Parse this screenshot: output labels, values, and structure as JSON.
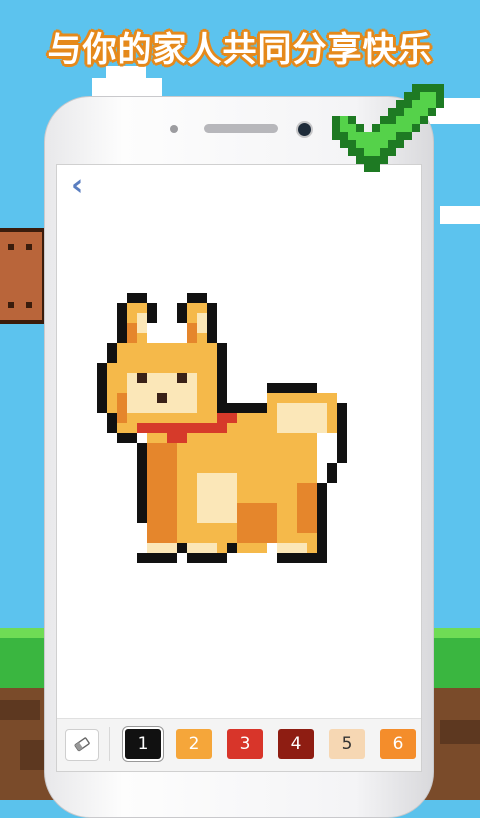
{
  "banner": {
    "text": "与你的家人共同分享快乐"
  },
  "screen": {
    "back_label": "‹"
  },
  "palette": {
    "eraser_icon": "eraser-icon",
    "colors": [
      {
        "label": "1",
        "color": "#111111",
        "text_color": "#ffffff",
        "selected": true
      },
      {
        "label": "2",
        "color": "#f5a63a",
        "text_color": "#ffffff"
      },
      {
        "label": "3",
        "color": "#d8352a",
        "text_color": "#ffffff"
      },
      {
        "label": "4",
        "color": "#8e1d12",
        "text_color": "#ffffff"
      },
      {
        "label": "5",
        "color": "#f6d7b3",
        "text_color": "#333333"
      },
      {
        "label": "6",
        "color": "#f48d2b",
        "text_color": "#ffffff"
      }
    ]
  },
  "colors": {
    "sky": "#5cc3ee",
    "grass": "#3ab640",
    "banner_stroke": "#e5891b",
    "check": "#3fbf3a"
  }
}
